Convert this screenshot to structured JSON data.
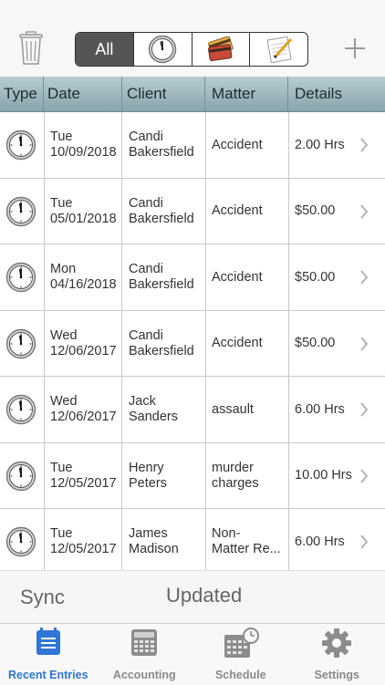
{
  "toolbar": {
    "filters": [
      {
        "label": "All",
        "icon": "",
        "active": true
      },
      {
        "label": "",
        "icon": "clock-icon",
        "active": false
      },
      {
        "label": "",
        "icon": "credit-cards-icon",
        "active": false
      },
      {
        "label": "",
        "icon": "notepad-pencil-icon",
        "active": false
      }
    ],
    "left_icon": "trash-icon",
    "right_icon": "plus-icon"
  },
  "table": {
    "columns": [
      "Type",
      "Date",
      "Client",
      "Matter",
      "Details"
    ],
    "rows": [
      {
        "type_icon": "clock-icon",
        "day": "Tue",
        "date": "10/09/2018",
        "client_first": "Candi",
        "client_last": "Bakersfield",
        "matter1": "Accident",
        "matter2": "",
        "details": "2.00 Hrs"
      },
      {
        "type_icon": "clock-icon",
        "day": "Tue",
        "date": "05/01/2018",
        "client_first": "Candi",
        "client_last": "Bakersfield",
        "matter1": "Accident",
        "matter2": "",
        "details": "$50.00"
      },
      {
        "type_icon": "clock-icon",
        "day": "Mon",
        "date": "04/16/2018",
        "client_first": "Candi",
        "client_last": "Bakersfield",
        "matter1": "Accident",
        "matter2": "",
        "details": "$50.00"
      },
      {
        "type_icon": "clock-icon",
        "day": "Wed",
        "date": "12/06/2017",
        "client_first": "Candi",
        "client_last": "Bakersfield",
        "matter1": "Accident",
        "matter2": "",
        "details": "$50.00"
      },
      {
        "type_icon": "clock-icon",
        "day": "Wed",
        "date": "12/06/2017",
        "client_first": "Jack",
        "client_last": "Sanders",
        "matter1": "assault",
        "matter2": "",
        "details": "6.00 Hrs"
      },
      {
        "type_icon": "clock-icon",
        "day": "Tue",
        "date": "12/05/2017",
        "client_first": "Henry",
        "client_last": "Peters",
        "matter1": "murder",
        "matter2": "charges",
        "details": "10.00 Hrs"
      },
      {
        "type_icon": "clock-icon",
        "day": "Tue",
        "date": "12/05/2017",
        "client_first": "James",
        "client_last": "Madison",
        "matter1": "Non-",
        "matter2": "Matter Re...",
        "details": "6.00 Hrs"
      }
    ]
  },
  "sync": {
    "label": "Sync",
    "status": "Updated"
  },
  "tabbar": {
    "active_color": "#2f75d7",
    "tabs": [
      {
        "label": "Recent Entries",
        "icon": "list-icon",
        "active": true
      },
      {
        "label": "Accounting",
        "icon": "calculator-icon",
        "active": false
      },
      {
        "label": "Schedule",
        "icon": "calendar-clock-icon",
        "active": false
      },
      {
        "label": "Settings",
        "icon": "gear-icon",
        "active": false
      }
    ]
  }
}
